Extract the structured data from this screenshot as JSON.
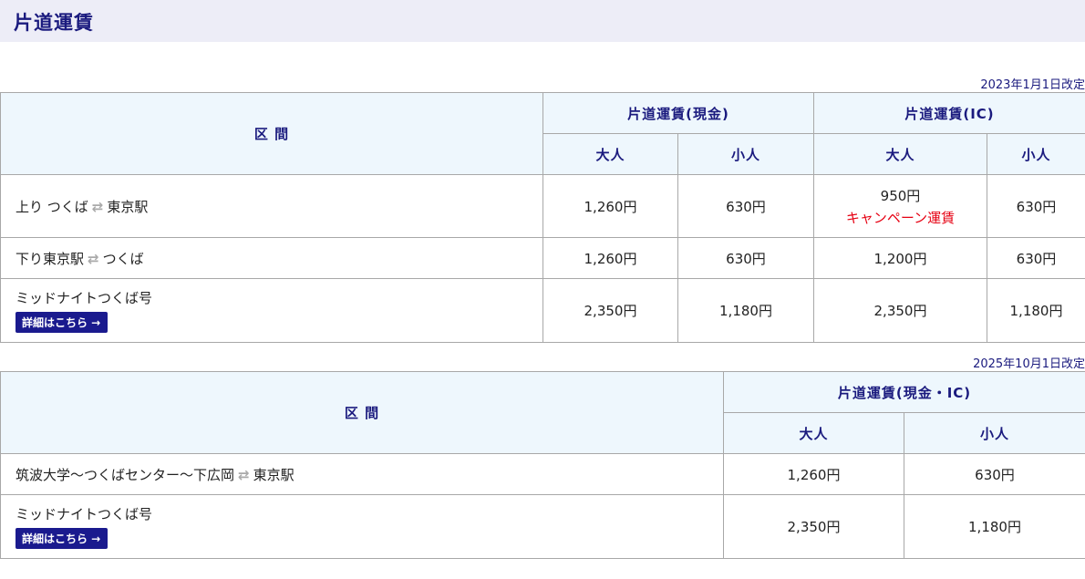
{
  "page_title": "片道運賃",
  "table1": {
    "revision": "2023年1月1日改定",
    "header": {
      "section": "区 間",
      "cash_group": "片道運賃(現金)",
      "ic_group": "片道運賃(IC)",
      "adult": "大人",
      "child": "小人"
    },
    "rows": [
      {
        "route_a": "上り つくば",
        "arrow": "⇄",
        "route_b": "東京駅",
        "cash_adult": "1,260円",
        "cash_child": "630円",
        "ic_adult": "950円",
        "ic_adult_note": "キャンペーン運賃",
        "ic_child": "630円"
      },
      {
        "route_a": "下り東京駅",
        "arrow": "⇄",
        "route_b": "つくば",
        "cash_adult": "1,260円",
        "cash_child": "630円",
        "ic_adult": "1,200円",
        "ic_child": "630円"
      },
      {
        "route_name": "ミッドナイトつくば号",
        "detail_label": "詳細はこちら →",
        "cash_adult": "2,350円",
        "cash_child": "1,180円",
        "ic_adult": "2,350円",
        "ic_child": "1,180円"
      }
    ]
  },
  "table2": {
    "revision": "2025年10月1日改定",
    "header": {
      "section": "区 間",
      "fare_group": "片道運賃(現金・IC)",
      "adult": "大人",
      "child": "小人"
    },
    "rows": [
      {
        "route_a": "筑波大学〜つくばセンター〜下広岡",
        "arrow": "⇄",
        "route_b": "東京駅",
        "adult": "1,260円",
        "child": "630円"
      },
      {
        "route_name": "ミッドナイトつくば号",
        "detail_label": "詳細はこちら →",
        "adult": "2,350円",
        "child": "1,180円"
      }
    ]
  },
  "colors": {
    "title_bg": "#ededf7",
    "heading_text": "#1a1a7e",
    "header_bg": "#eef7fd",
    "campaign_red": "#e60012",
    "button_bg": "#1a1a8e",
    "border": "#a8a8a8"
  }
}
